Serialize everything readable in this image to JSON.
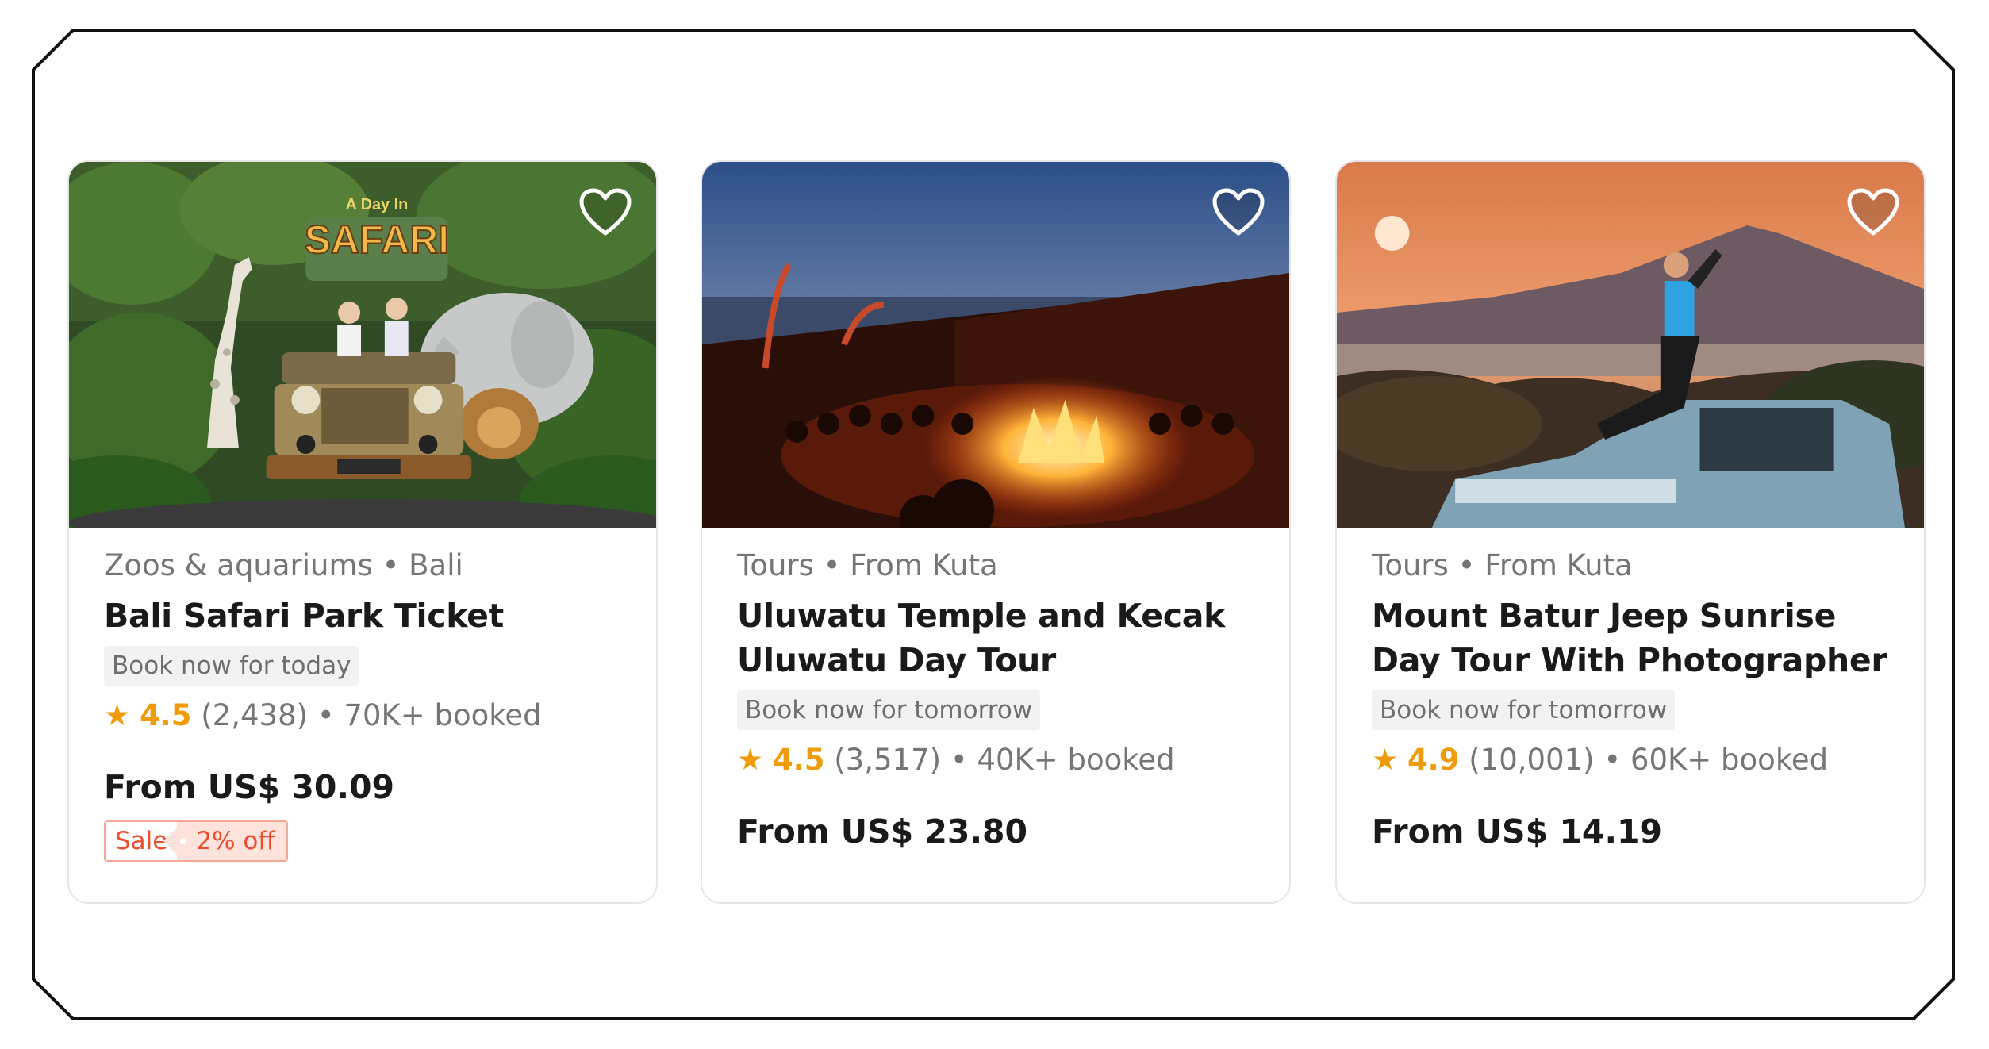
{
  "cards": [
    {
      "category": "Zoos & aquariums • Bali",
      "title": "Bali Safari Park Ticket",
      "availability": "Book now for today",
      "rating": "4.5",
      "reviews": "(2,438)",
      "booked": "• 70K+ booked",
      "price": "From US$ 30.09",
      "sale_label": "Sale",
      "discount": "2% off",
      "image_sign": "A Day In SAFARI"
    },
    {
      "category": "Tours • From Kuta",
      "title": "Uluwatu Temple and Kecak Uluwatu Day Tour",
      "availability": "Book now for tomorrow",
      "rating": "4.5",
      "reviews": "(3,517)",
      "booked": "• 40K+ booked",
      "price": "From US$ 23.80"
    },
    {
      "category": "Tours • From Kuta",
      "title": "Mount Batur Jeep Sunrise Day Tour With Photographer",
      "availability": "Book now for tomorrow",
      "rating": "4.9",
      "reviews": "(10,001)",
      "booked": "• 60K+ booked",
      "price": "From US$ 14.19"
    }
  ],
  "colors": {
    "rating": "#f09b0a",
    "sale": "#ee4d2d",
    "title": "#1a1a1a",
    "muted": "#757575"
  },
  "icons": {
    "wishlist": "heart-outline-icon",
    "rating": "star-icon"
  }
}
